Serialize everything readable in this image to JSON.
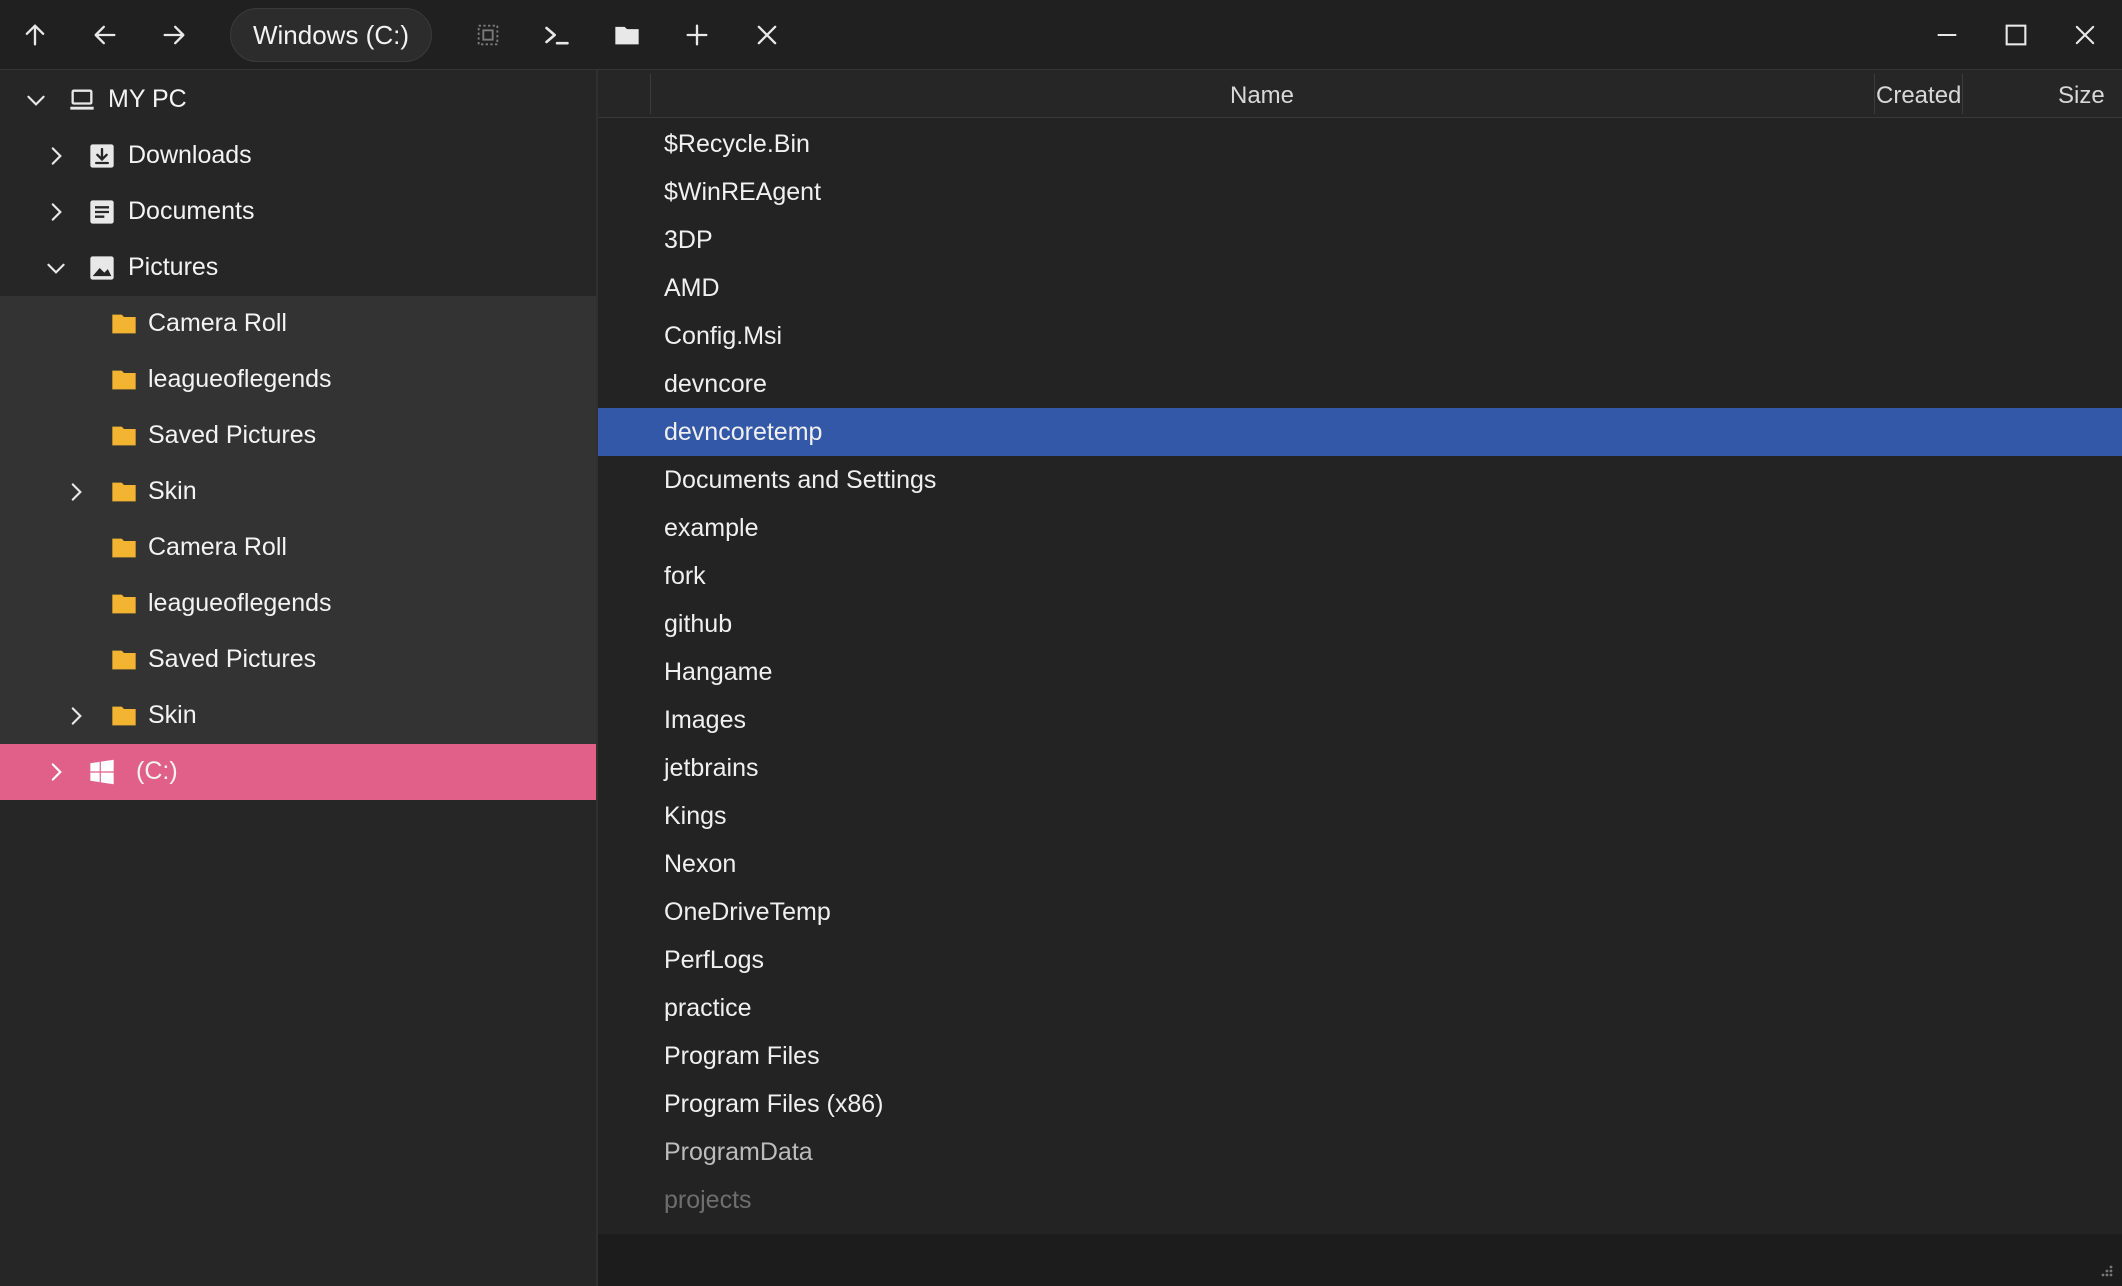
{
  "toolbar": {
    "path": "Windows (C:)"
  },
  "sidebar": {
    "root": "MY PC",
    "items": [
      {
        "label": "Downloads"
      },
      {
        "label": "Documents"
      },
      {
        "label": "Pictures"
      },
      {
        "label": "Camera Roll"
      },
      {
        "label": "leagueoflegends"
      },
      {
        "label": "Saved Pictures"
      },
      {
        "label": "Skin"
      },
      {
        "label": "Camera Roll"
      },
      {
        "label": "leagueoflegends"
      },
      {
        "label": "Saved Pictures"
      },
      {
        "label": "Skin"
      },
      {
        "label": "(C:)"
      }
    ]
  },
  "columns": {
    "name": "Name",
    "created": "Created",
    "size": "Size"
  },
  "files": [
    "$Recycle.Bin",
    "$WinREAgent",
    "3DP",
    "AMD",
    "Config.Msi",
    "devncore",
    "devncoretemp",
    "Documents and Settings",
    "example",
    "fork",
    "github",
    "Hangame",
    "Images",
    "jetbrains",
    "Kings",
    "Nexon",
    "OneDriveTemp",
    "PerfLogs",
    "practice",
    "Program Files",
    "Program Files (x86)",
    "ProgramData",
    "projects"
  ],
  "selected_file": "devncoretemp",
  "colors": {
    "background": "#202020",
    "sidebar": "#262626",
    "sidebar_child": "#333333",
    "sidebar_selected": "#e0608a",
    "file_selected": "#3358a8",
    "folder": "#f2b431"
  }
}
